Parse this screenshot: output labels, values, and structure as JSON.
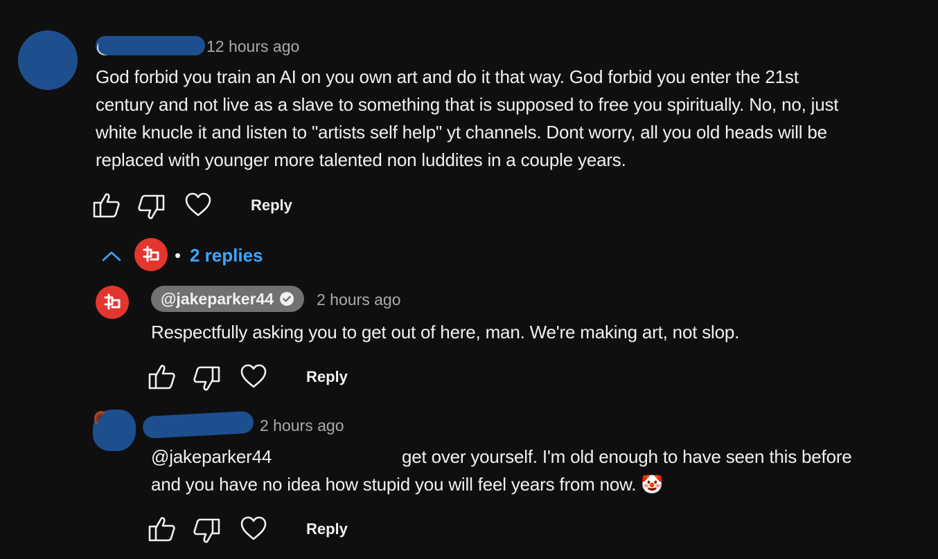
{
  "comment": {
    "time": "12 hours ago",
    "lines": [
      "God forbid you train an AI on you own art and do it that way. God forbid you enter the 21st",
      "century and not live as a slave to something that is supposed to free you spiritually. No, no, just",
      "white knucle it and listen to \"artists self help\" yt channels. Dont worry, all you old heads will be",
      "replaced with younger more talented non luddites in a couple years."
    ],
    "reply_label": "Reply"
  },
  "replies_toggle": {
    "bullet": "•",
    "label": "2 replies"
  },
  "reply1": {
    "author": "@jakeparker44",
    "time": "2 hours ago",
    "text": "Respectfully asking you to get out of here, man. We're making art, not slop.",
    "reply_label": "Reply"
  },
  "reply2": {
    "time": "2 hours ago",
    "mention": "@jakeparker44",
    "line1": "get over yourself. I'm old enough to have seen this before",
    "line2": "and you have no idea how stupid you will feel years from now.",
    "emoji": "🤡",
    "reply_label": "Reply"
  },
  "icons": {
    "like": "thumbs-up-icon",
    "dislike": "thumbs-down-icon",
    "heart": "heart-icon",
    "chevron": "chevron-up-icon",
    "verified": "verified-check-icon"
  },
  "colors": {
    "background": "#0f0f0f",
    "text": "#f1f1f1",
    "secondary_text": "#aaaaaa",
    "link_blue": "#3ea6ff",
    "creator_red": "#e2362f",
    "author_chip": "#717171",
    "redaction_blue": "#1d4f8e"
  }
}
